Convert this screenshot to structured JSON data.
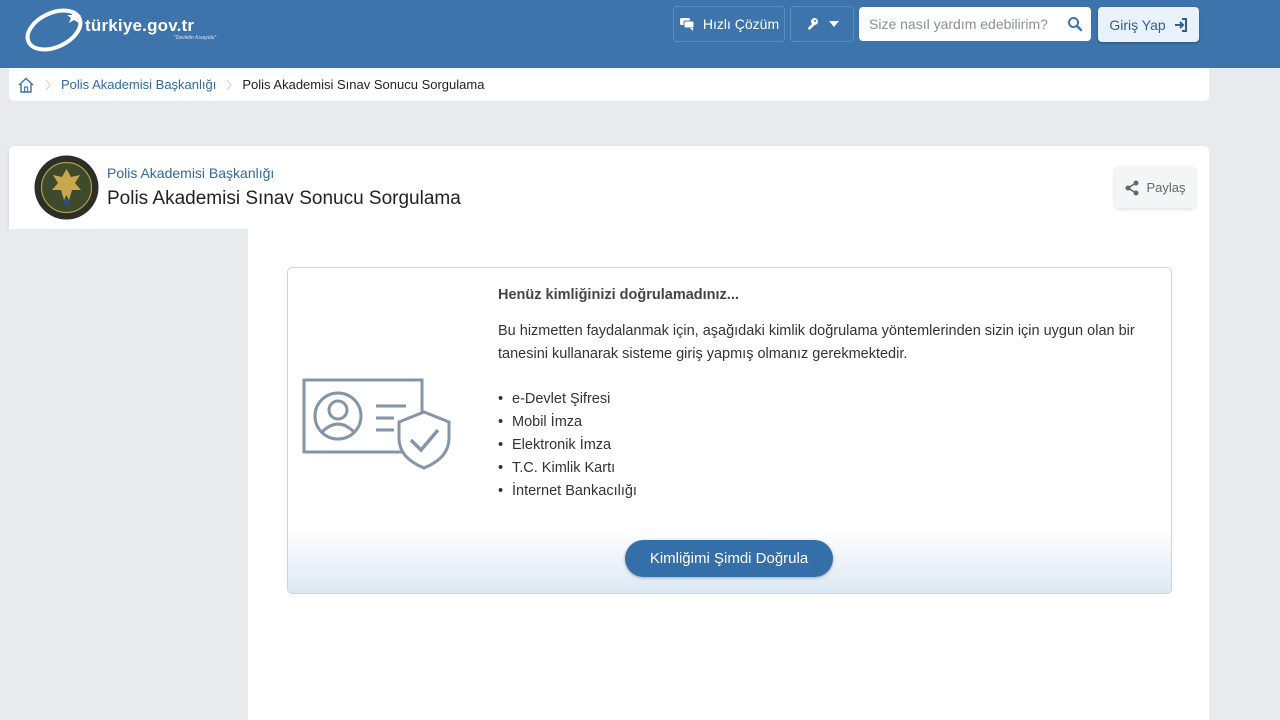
{
  "header": {
    "logo_text": "türkiye.gov.tr",
    "logo_slogan": "\"Devletin Kısayolu\"",
    "quick_solution_label": "Hızlı Çözüm",
    "search_placeholder": "Size nasıl yardım edebilirim?",
    "login_label": "Giriş Yap"
  },
  "breadcrumb": {
    "items": [
      "Polis Akademisi Başkanlığı",
      "Polis Akademisi Sınav Sonucu Sorgulama"
    ]
  },
  "page": {
    "institution": "Polis Akademisi Başkanlığı",
    "title": "Polis Akademisi Sınav Sonucu Sorgulama",
    "share_label": "Paylaş",
    "emblem_text": "POLİS AKADEMİSİ"
  },
  "auth": {
    "heading": "Henüz kimliğinizi doğrulamadınız...",
    "description": "Bu hizmetten faydalanmak için, aşağıdaki kimlik doğrulama yöntemlerinden sizin için uygun olan bir tanesini kullanarak sisteme giriş yapmış olmanız gerekmektedir.",
    "methods": [
      "e-Devlet Şifresi",
      "Mobil İmza",
      "Elektronik İmza",
      "T.C. Kimlik Kartı",
      "İnternet Bankacılığı"
    ],
    "button_label": "Kimliğimi Şimdi Doğrula"
  },
  "colors": {
    "topbar": "#3c74ab",
    "link": "#2f6aa3",
    "button": "#356fa9",
    "background": "#e8ebee"
  }
}
